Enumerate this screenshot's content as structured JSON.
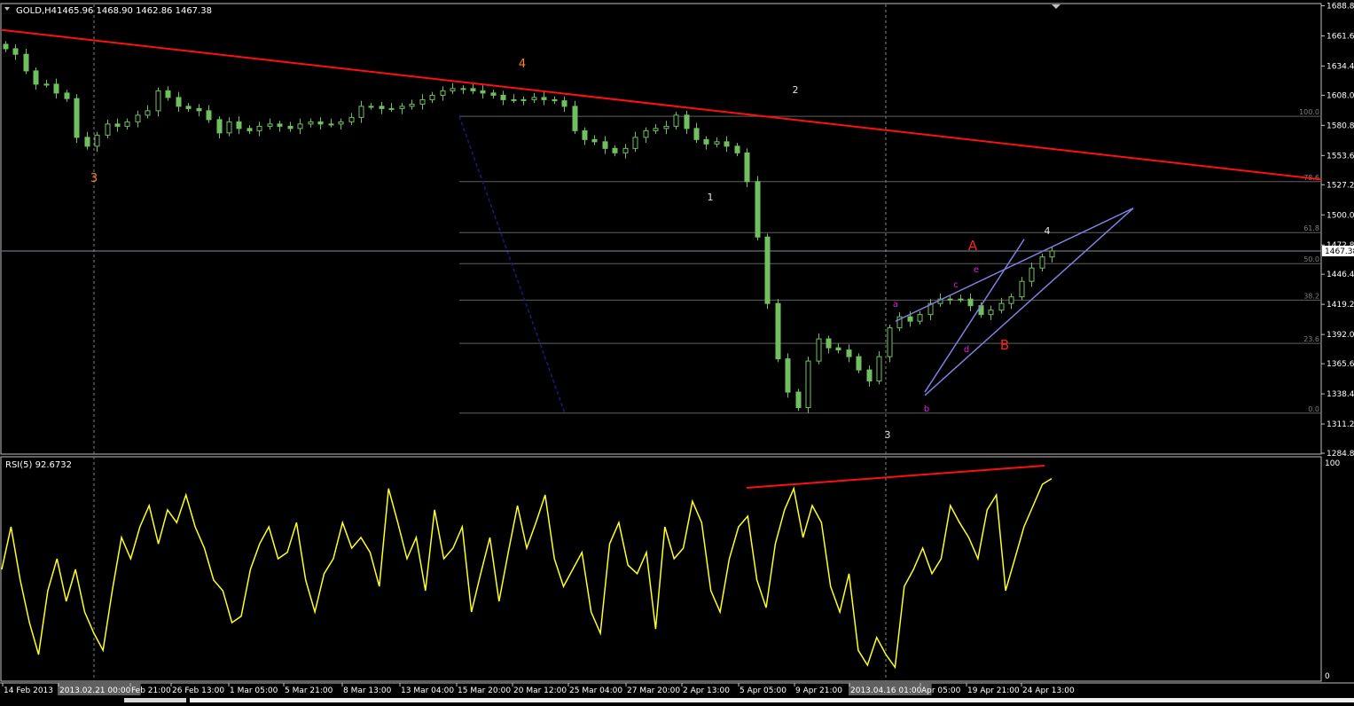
{
  "header": {
    "symbol_label": "GOLD,H4",
    "ohlc": "1465.96 1468.90 1462.86 1467.38",
    "rsi_label": "RSI(5) 92.6732"
  },
  "colors": {
    "background": "#000000",
    "frame": "#c0c0c0",
    "candle": "#70c060",
    "trendline": "#ff1010",
    "fib": "#606060",
    "wedge": "#8080e0",
    "rsi": "#ffff20",
    "wave_orange": "#ff8020",
    "wave_white": "#e0e0e0",
    "wave_red": "#ff2020",
    "wave_magenta": "#e020e0",
    "date_highlight_bg": "#606060"
  },
  "chart_data": [
    {
      "type": "candlestick",
      "symbol": "GOLD",
      "timeframe": "H4",
      "current_price": 1467.38,
      "current_price_label": "1467.38",
      "y_range": [
        1284,
        1690
      ],
      "price_ticks": [
        "1688.80",
        "1661.60",
        "1634.40",
        "1608.00",
        "1580.80",
        "1553.60",
        "1527.20",
        "1500.00",
        "1472.80",
        "1446.40",
        "1419.20",
        "1392.00",
        "1365.60",
        "1338.40",
        "1311.20",
        "1284.80"
      ],
      "date_labels": [
        {
          "label": "14 Feb 2013"
        },
        {
          "label": "2013.02.21 00:00",
          "highlight": true
        },
        {
          "label": "Feb 21:00"
        },
        {
          "label": "26 Feb 13:00"
        },
        {
          "label": "1 Mar 05:00"
        },
        {
          "label": "5 Mar 21:00"
        },
        {
          "label": "8 Mar 13:00"
        },
        {
          "label": "13 Mar 04:00"
        },
        {
          "label": "15 Mar 20:00"
        },
        {
          "label": "20 Mar 12:00"
        },
        {
          "label": "25 Mar 04:00"
        },
        {
          "label": "27 Mar 20:00"
        },
        {
          "label": "2 Apr 13:00"
        },
        {
          "label": "5 Apr 05:00"
        },
        {
          "label": "9 Apr 21:00"
        },
        {
          "label": "2013.04.16 01:00",
          "highlight": true
        },
        {
          "label": "Apr 05:00"
        },
        {
          "label": "19 Apr 21:00"
        },
        {
          "label": "24 Apr 13:00"
        }
      ],
      "fibonacci_levels": [
        {
          "label": "100.0",
          "price": 1589
        },
        {
          "label": "78.6",
          "price": 1530
        },
        {
          "label": "61.8",
          "price": 1484
        },
        {
          "label": "50.0",
          "price": 1456
        },
        {
          "label": "38.2",
          "price": 1423
        },
        {
          "label": "23.6",
          "price": 1384
        },
        {
          "label": "0.0",
          "price": 1321
        }
      ],
      "wave_labels": [
        {
          "text": "3",
          "color": "orange"
        },
        {
          "text": "4",
          "color": "orange"
        },
        {
          "text": "1",
          "color": "white"
        },
        {
          "text": "2",
          "color": "white"
        },
        {
          "text": "3",
          "color": "white"
        },
        {
          "text": "4",
          "color": "white"
        },
        {
          "text": "A",
          "color": "red"
        },
        {
          "text": "B",
          "color": "red"
        },
        {
          "text": "a",
          "color": "magenta"
        },
        {
          "text": "b",
          "color": "magenta"
        },
        {
          "text": "c",
          "color": "magenta"
        },
        {
          "text": "d",
          "color": "magenta"
        },
        {
          "text": "e",
          "color": "magenta"
        }
      ],
      "close_series": [
        1650,
        1645,
        1630,
        1618,
        1618,
        1610,
        1605,
        1570,
        1562,
        1572,
        1582,
        1580,
        1584,
        1590,
        1594,
        1612,
        1606,
        1598,
        1596,
        1594,
        1586,
        1574,
        1584,
        1578,
        1576,
        1580,
        1582,
        1580,
        1578,
        1582,
        1584,
        1582,
        1582,
        1584,
        1588,
        1598,
        1598,
        1596,
        1596,
        1598,
        1600,
        1604,
        1608,
        1612,
        1614,
        1614,
        1612,
        1610,
        1608,
        1604,
        1604,
        1604,
        1606,
        1604,
        1603,
        1598,
        1576,
        1568,
        1566,
        1560,
        1556,
        1560,
        1570,
        1576,
        1578,
        1580,
        1590,
        1578,
        1568,
        1564,
        1566,
        1562,
        1556,
        1530,
        1480,
        1420,
        1370,
        1340,
        1326,
        1368,
        1388,
        1380,
        1378,
        1372,
        1360,
        1350,
        1372,
        1398,
        1408,
        1404,
        1410,
        1420,
        1424,
        1424,
        1424,
        1418,
        1410,
        1414,
        1420,
        1426,
        1440,
        1452,
        1462,
        1467.38
      ]
    },
    {
      "type": "line",
      "name": "RSI(5) 92.6732",
      "period": 5,
      "last_value": 92.6732,
      "y_range": [
        0,
        100
      ],
      "y_ticks": [
        "100",
        "0"
      ],
      "values": [
        50,
        70,
        45,
        25,
        10,
        40,
        55,
        35,
        50,
        30,
        20,
        12,
        40,
        65,
        55,
        70,
        80,
        62,
        78,
        72,
        85,
        70,
        60,
        45,
        40,
        25,
        28,
        50,
        62,
        70,
        55,
        58,
        72,
        45,
        30,
        48,
        55,
        72,
        60,
        65,
        58,
        42,
        88,
        72,
        55,
        65,
        40,
        78,
        55,
        60,
        70,
        30,
        48,
        65,
        35,
        58,
        80,
        60,
        72,
        85,
        55,
        42,
        50,
        58,
        30,
        20,
        62,
        72,
        52,
        48,
        58,
        22,
        70,
        55,
        60,
        82,
        72,
        40,
        30,
        55,
        70,
        75,
        45,
        32,
        62,
        78,
        88,
        65,
        80,
        72,
        42,
        30,
        48,
        12,
        5,
        18,
        10,
        4,
        42,
        50,
        60,
        48,
        55,
        80,
        72,
        65,
        55,
        78,
        85,
        40,
        55,
        70,
        80,
        90,
        92.6732
      ]
    }
  ]
}
